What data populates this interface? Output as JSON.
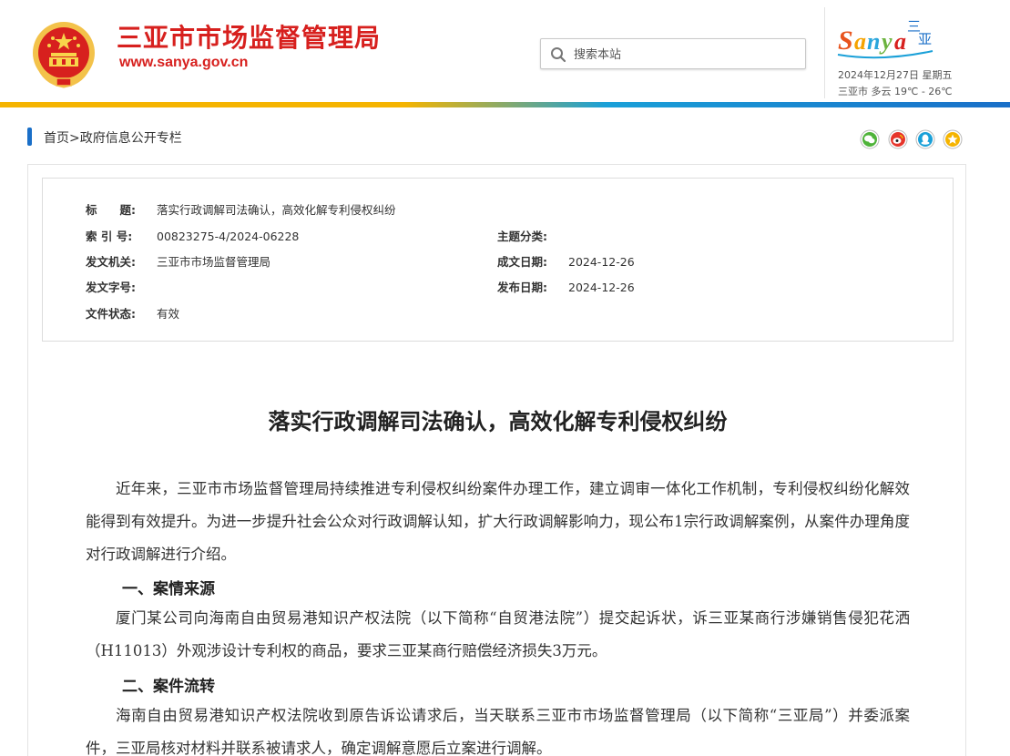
{
  "header": {
    "site_title": "三亚市市场监督管理局",
    "site_url": "www.sanya.gov.cn",
    "search_placeholder": "搜索本站",
    "logo_text": "Sanya",
    "logo_chinese": "三亚",
    "date": "2024年12月27日 星期五",
    "weather": "三亚市  多云  19℃ - 26℃"
  },
  "breadcrumb": {
    "home": "首页",
    "separator": ">",
    "section": "政府信息公开专栏"
  },
  "share": [
    "wechat-icon",
    "weibo-icon",
    "qq-icon",
    "favorite-icon"
  ],
  "colors": {
    "brand_red": "#d7201e",
    "accent_blue": "#1a6fc8",
    "accent_yellow": "#f5b400"
  },
  "meta": {
    "title_label": "标　　题:",
    "title_value": "落实行政调解司法确认，高效化解专利侵权纠纷",
    "index_label": "索 引 号:",
    "index_value": "00823275-4/2024-06228",
    "topic_label": "主题分类:",
    "topic_value": "",
    "issuer_label": "发文机关:",
    "issuer_value": "三亚市市场监督管理局",
    "created_label": "成文日期:",
    "created_value": "2024-12-26",
    "docno_label": "发文字号:",
    "docno_value": "",
    "published_label": "发布日期:",
    "published_value": "2024-12-26",
    "status_label": "文件状态:",
    "status_value": "有效"
  },
  "article": {
    "title": "落实行政调解司法确认，高效化解专利侵权纠纷",
    "intro": "近年来，三亚市市场监督管理局持续推进专利侵权纠纷案件办理工作，建立调审一体化工作机制，专利侵权纠纷化解效能得到有效提升。为进一步提升社会公众对行政调解认知，扩大行政调解影响力，现公布1宗行政调解案例，从案件办理角度对行政调解进行介绍。",
    "h1": "一、案情来源",
    "p1": "厦门某公司向海南自由贸易港知识产权法院（以下简称“自贸港法院”）提交起诉状，诉三亚某商行涉嫌销售侵犯花洒（H11013）外观涉设计专利权的商品，要求三亚某商行赔偿经济损失3万元。",
    "h2": "二、案件流转",
    "p2": "海南自由贸易港知识产权法院收到原告诉讼请求后，当天联系三亚市市场监督管理局（以下简称“三亚局”）并委派案件，三亚局核对材料并联系被请求人，确定调解意愿后立案进行调解。"
  }
}
